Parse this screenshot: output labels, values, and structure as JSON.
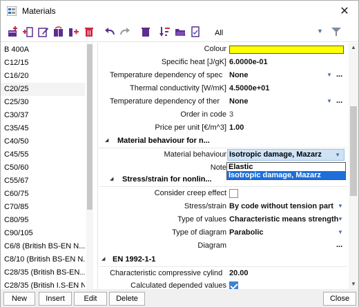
{
  "window": {
    "title": "Materials",
    "close_glyph": "✕"
  },
  "toolbar": {
    "filter_value": "All",
    "icons": [
      "new-icon",
      "insert-icon",
      "edit-icon",
      "copy-icon",
      "add-icon",
      "delete-icon",
      "undo-icon",
      "redo-icon",
      "trash-icon",
      "sort-icon",
      "open-icon",
      "document-icon"
    ],
    "dropdown_glyph": "▼",
    "filter_icon": "funnel-icon"
  },
  "materials_list": {
    "selected": "C20/25",
    "items": [
      "B 400A",
      "C12/15",
      "C16/20",
      "C20/25",
      "C25/30",
      "C30/37",
      "C35/45",
      "C40/50",
      "C45/55",
      "C50/60",
      "C55/67",
      "C60/75",
      "C70/85",
      "C80/95",
      "C90/105",
      "C6/8 (British BS-EN N...",
      "C8/10 (British BS-EN N...",
      "C28/35 (British BS-EN...",
      "C28/35 (British I.S-EN N..."
    ]
  },
  "properties": {
    "colour_label": "Colour",
    "colour_value": "#ffff00",
    "specific_heat_label": "Specific heat [J/gK]",
    "specific_heat_value": "6.0000e-01",
    "temp_dep_spec_label": "Temperature dependency of spec",
    "temp_dep_spec_value": "None",
    "thermal_cond_label": "Thermal conductivity [W/mK]",
    "thermal_cond_value": "4.5000e+01",
    "temp_dep_ther_label": "Temperature dependency of ther",
    "temp_dep_ther_value": "None",
    "order_label": "Order in code",
    "order_value": "3",
    "price_label": "Price per unit [€/m^3]",
    "price_value": "1.00",
    "section_behaviour": "Material behaviour for n...",
    "behaviour_label": "Material behaviour",
    "behaviour_value": "Isotropic damage, Mazarz",
    "note_label": "Note",
    "section_stress": "Stress/strain for nonlin...",
    "creep_label": "Consider creep effect",
    "stress_label": "Stress/strain",
    "stress_value": "By code without tension part",
    "type_values_label": "Type of values",
    "type_values_value": "Characteristic means strength",
    "type_diagram_label": "Type of diagram",
    "type_diagram_value": "Parabolic",
    "diagram_label": "Diagram",
    "section_en": "EN 1992-1-1",
    "char_comp_label": "Characteristic compressive cylind",
    "char_comp_value": "20.00",
    "calc_dep_label": "Calculated depended values",
    "ellipsis": "...",
    "expand_glyph": "◢",
    "dropdown_glyph": "▼"
  },
  "behaviour_popup": {
    "options": [
      "Elastic",
      "Isotropic damage, Mazarz"
    ],
    "selected": "Isotropic damage, Mazarz"
  },
  "buttons": {
    "new": "New",
    "insert": "Insert",
    "edit": "Edit",
    "delete": "Delete",
    "close": "Close"
  },
  "scroll_glyphs": {
    "up": "▲",
    "down": "▼"
  }
}
